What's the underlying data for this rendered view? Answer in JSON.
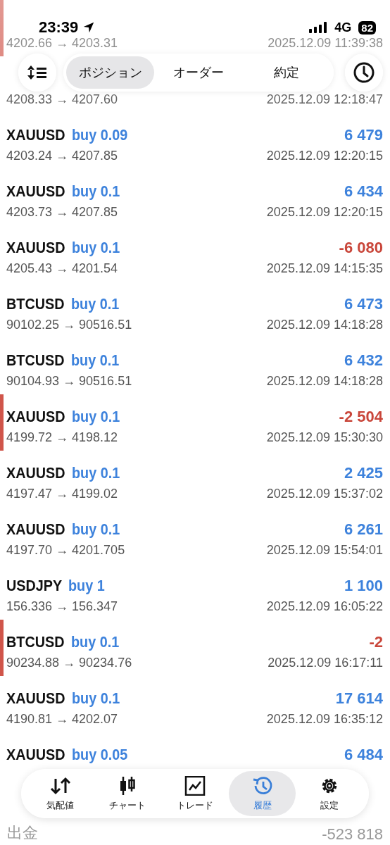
{
  "status_bar": {
    "time": "23:39",
    "network": "4G",
    "battery": "82"
  },
  "top_tabs": [
    {
      "label": "ポジション",
      "selected": true
    },
    {
      "label": "オーダー",
      "selected": false
    },
    {
      "label": "約定",
      "selected": false
    }
  ],
  "deals": [
    {
      "marked": true,
      "prices": "4202.66 → 4203.31",
      "time": "2025.12.09 11:39:38"
    },
    {
      "marked": false,
      "prices": "4208.33 → 4207.60",
      "time": "2025.12.09 12:18:47"
    },
    {
      "symbol": "XAUUSD",
      "side": "buy 0.09",
      "profit": "6 479",
      "loss": false,
      "marked": false,
      "prices": "4203.24 → 4207.85",
      "time": "2025.12.09 12:20:15"
    },
    {
      "symbol": "XAUUSD",
      "side": "buy 0.1",
      "profit": "6 434",
      "loss": false,
      "marked": false,
      "prices": "4203.73 → 4207.85",
      "time": "2025.12.09 12:20:15"
    },
    {
      "symbol": "XAUUSD",
      "side": "buy 0.1",
      "profit": "-6 080",
      "loss": true,
      "marked": false,
      "prices": "4205.43 → 4201.54",
      "time": "2025.12.09 14:15:35"
    },
    {
      "symbol": "BTCUSD",
      "side": "buy 0.1",
      "profit": "6 473",
      "loss": false,
      "marked": false,
      "prices": "90102.25 → 90516.51",
      "time": "2025.12.09 14:18:28"
    },
    {
      "symbol": "BTCUSD",
      "side": "buy 0.1",
      "profit": "6 432",
      "loss": false,
      "marked": false,
      "prices": "90104.93 → 90516.51",
      "time": "2025.12.09 14:18:28"
    },
    {
      "symbol": "XAUUSD",
      "side": "buy 0.1",
      "profit": "-2 504",
      "loss": true,
      "marked": true,
      "prices": "4199.72 → 4198.12",
      "time": "2025.12.09 15:30:30"
    },
    {
      "symbol": "XAUUSD",
      "side": "buy 0.1",
      "profit": "2 425",
      "loss": false,
      "marked": false,
      "prices": "4197.47 → 4199.02",
      "time": "2025.12.09 15:37:02"
    },
    {
      "symbol": "XAUUSD",
      "side": "buy 0.1",
      "profit": "6 261",
      "loss": false,
      "marked": false,
      "prices": "4197.70 → 4201.705",
      "time": "2025.12.09 15:54:01"
    },
    {
      "symbol": "USDJPY",
      "side": "buy 1",
      "profit": "1 100",
      "loss": false,
      "marked": false,
      "prices": "156.336 → 156.347",
      "time": "2025.12.09 16:05:22"
    },
    {
      "symbol": "BTCUSD",
      "side": "buy 0.1",
      "profit": "-2",
      "loss": true,
      "marked": true,
      "prices": "90234.88 → 90234.76",
      "time": "2025.12.09 16:17:11"
    },
    {
      "symbol": "XAUUSD",
      "side": "buy 0.1",
      "profit": "17 614",
      "loss": false,
      "marked": false,
      "prices": "4190.81 → 4202.07",
      "time": "2025.12.09 16:35:12"
    },
    {
      "symbol": "XAUUSD",
      "side": "buy 0.05",
      "profit": "6 484",
      "loss": false,
      "marked": false
    }
  ],
  "summary": [
    {
      "label": "出金",
      "value": "-523 818"
    }
  ],
  "bottom_nav": [
    {
      "kind": "quotes",
      "label": "気配値",
      "selected": false
    },
    {
      "kind": "chart",
      "label": "チャート",
      "selected": false
    },
    {
      "kind": "trade",
      "label": "トレード",
      "selected": false
    },
    {
      "kind": "history",
      "label": "履歴",
      "selected": true
    },
    {
      "kind": "settings",
      "label": "設定",
      "selected": false
    }
  ]
}
